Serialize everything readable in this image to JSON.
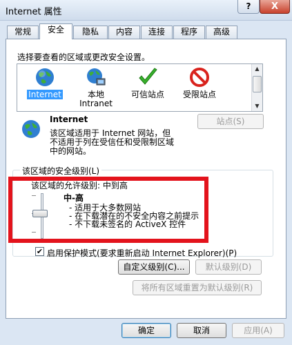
{
  "window": {
    "title": "Internet 属性",
    "help_label": "?",
    "close_label": "X"
  },
  "tabs": [
    "常规",
    "安全",
    "隐私",
    "内容",
    "连接",
    "程序",
    "高级"
  ],
  "active_tab": "安全",
  "security": {
    "choose_zone_label": "选择要查看的区域或更改安全设置。",
    "zones": [
      {
        "label": "Internet",
        "label2": "",
        "icon": "globe-icon",
        "selected": true
      },
      {
        "label": "本地",
        "label2": "Intranet",
        "icon": "network-globe-icon",
        "selected": false
      },
      {
        "label": "可信站点",
        "label2": "",
        "icon": "checkmark-icon",
        "selected": false
      },
      {
        "label": "受限站点",
        "label2": "",
        "icon": "restricted-icon",
        "selected": false
      }
    ],
    "zone_info": {
      "title": "Internet",
      "desc_line1": "该区域适用于 Internet 网站，但",
      "desc_line2": "不适用于列在受信任和受限制区域",
      "desc_line3": "中的网站。"
    },
    "sites_button": "站点(S)",
    "level_group_label": "该区域的安全级别(L)",
    "allowed_levels_label": "该区域的允许级别: 中到高",
    "level": {
      "name": "中-高",
      "bullet1": "- 适用于大多数网站",
      "bullet2": "- 在下载潜在的不安全内容之前提示",
      "bullet3": "- 不下载未签名的 ActiveX 控件"
    },
    "protected_mode_label": "启用保护模式(要求重新启动 Internet Explorer)(P)",
    "protected_mode_checked": true,
    "custom_level_button": "自定义级别(C)...",
    "default_level_button": "默认级别(D)",
    "reset_all_button": "将所有区域重置为默认级别(R)"
  },
  "footer": {
    "ok": "确定",
    "cancel": "取消",
    "apply": "应用(A)"
  },
  "colors": {
    "highlight": "#3399ff",
    "annotation_box": "#e3131c"
  }
}
